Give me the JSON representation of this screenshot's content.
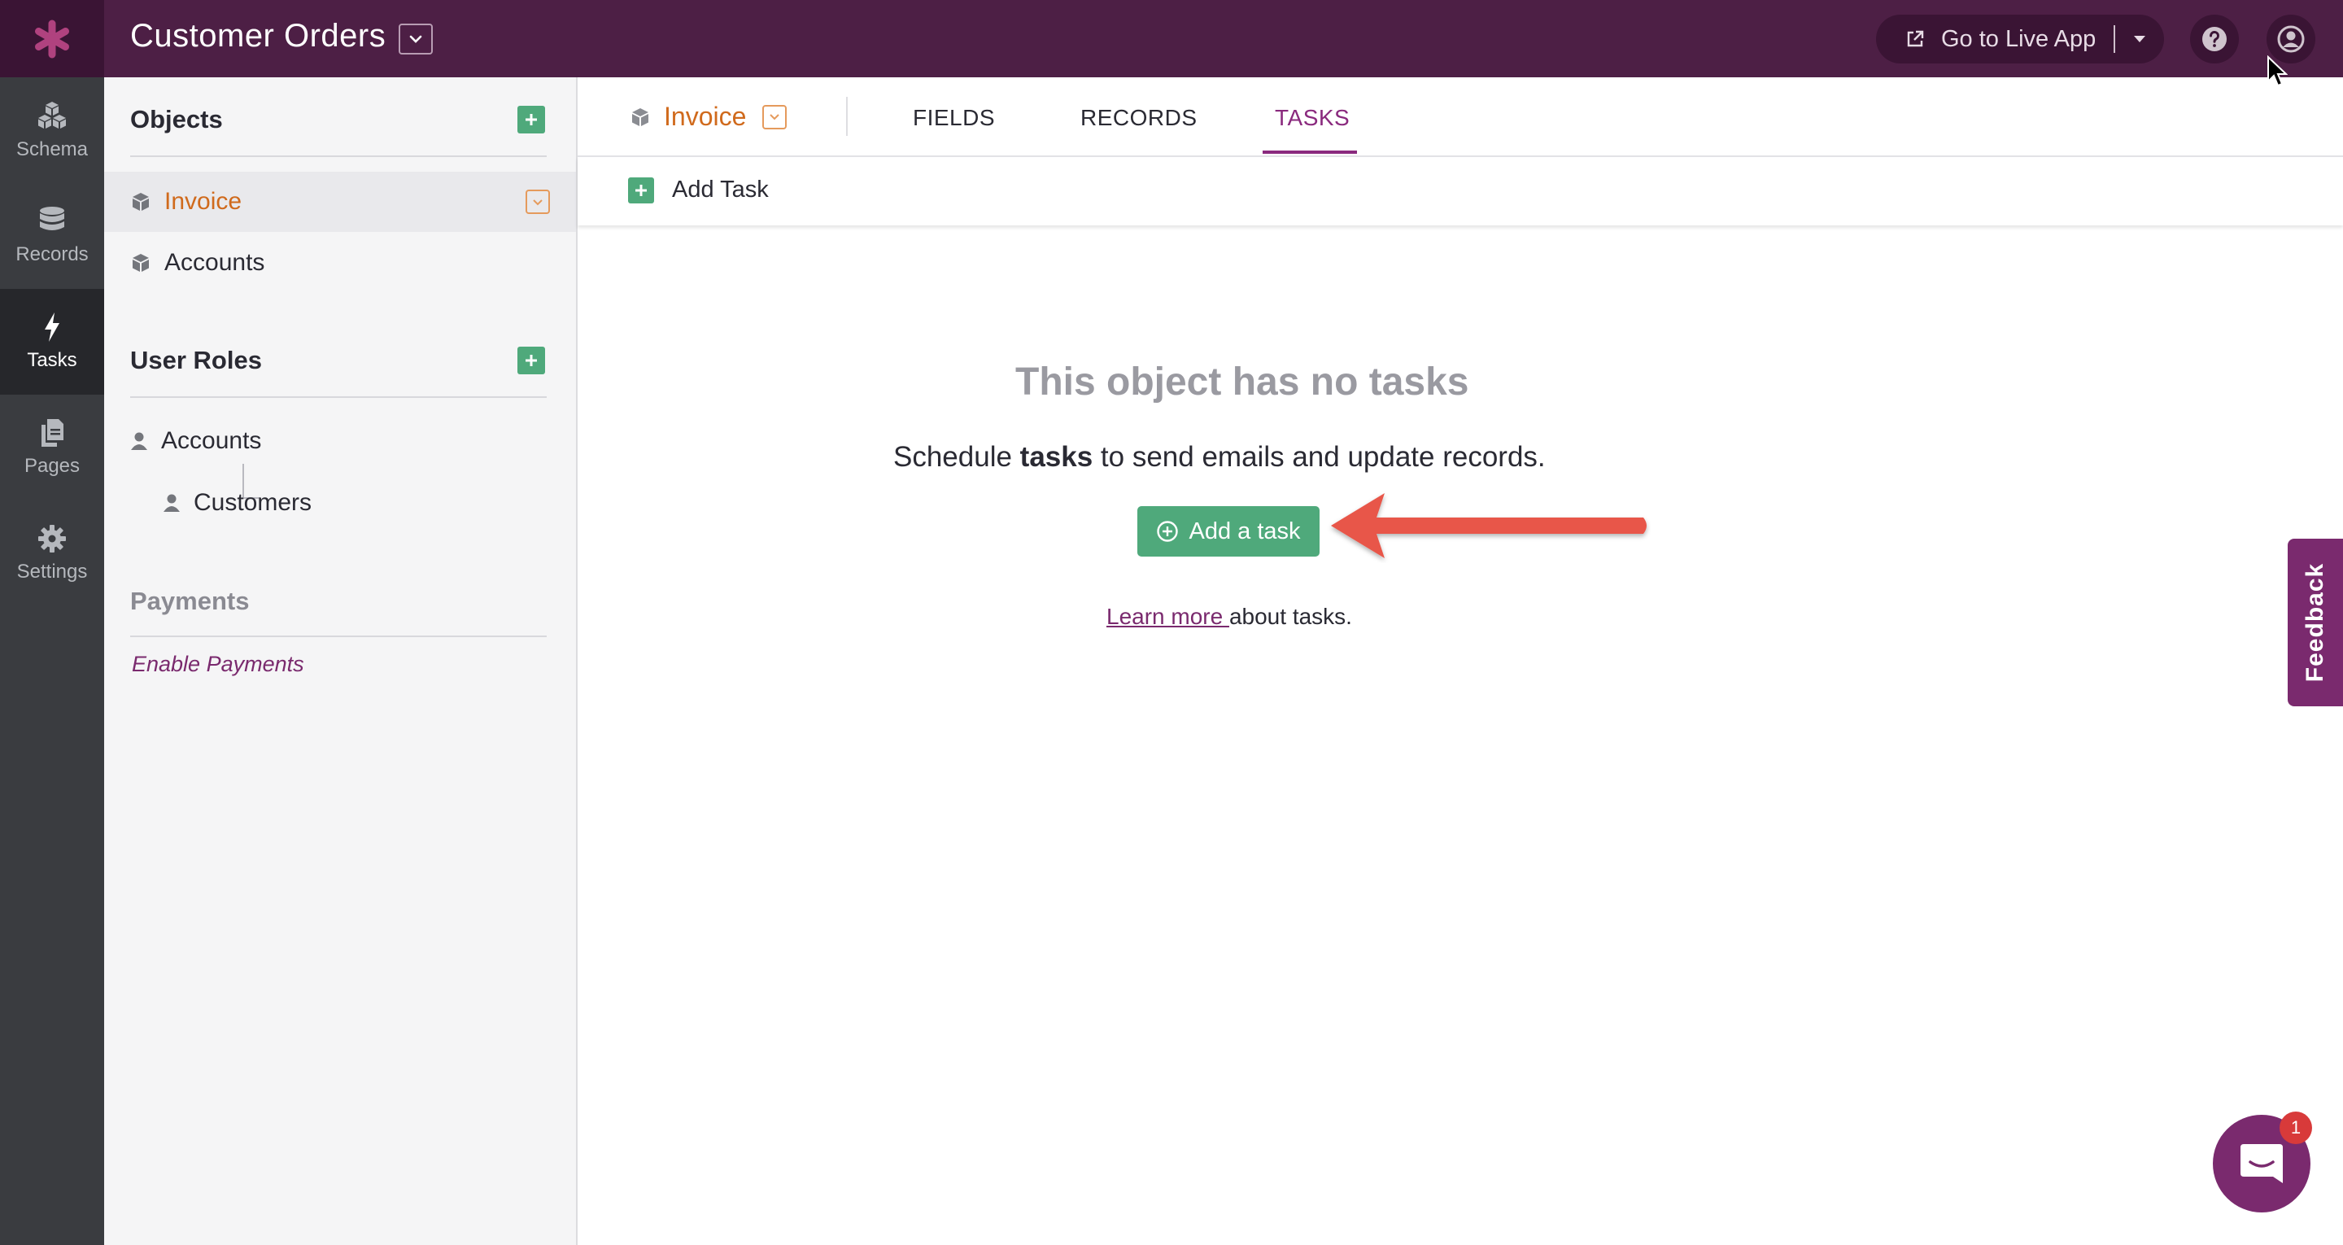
{
  "app": {
    "title": "Customer Orders"
  },
  "header": {
    "live_app_label": "Go to Live App",
    "help_icon": "help-circle-icon",
    "account_icon": "user-circle-icon"
  },
  "nav": {
    "items": [
      {
        "label": "Schema",
        "icon": "cubes-icon",
        "active": false
      },
      {
        "label": "Records",
        "icon": "database-icon",
        "active": false
      },
      {
        "label": "Tasks",
        "icon": "bolt-icon",
        "active": true
      },
      {
        "label": "Pages",
        "icon": "pages-icon",
        "active": false
      },
      {
        "label": "Settings",
        "icon": "gear-icon",
        "active": false
      }
    ]
  },
  "sidebar": {
    "objects_heading": "Objects",
    "objects": [
      {
        "label": "Invoice",
        "selected": true
      },
      {
        "label": "Accounts",
        "selected": false
      }
    ],
    "user_roles_heading": "User Roles",
    "user_roles": [
      {
        "label": "Accounts"
      },
      {
        "label": "Customers"
      }
    ],
    "payments_heading": "Payments",
    "enable_payments": "Enable Payments"
  },
  "main": {
    "object_name": "Invoice",
    "tabs": [
      {
        "label": "FIELDS",
        "active": false
      },
      {
        "label": "RECORDS",
        "active": false
      },
      {
        "label": "TASKS",
        "active": true
      }
    ],
    "toolbar_add_task": "Add Task",
    "empty_state": {
      "title": "This object has no tasks",
      "desc_before": "Schedule ",
      "desc_bold": "tasks",
      "desc_after": " to send emails and update records.",
      "button_label": "Add a task",
      "learn_more": "Learn more ",
      "learn_after": "about tasks."
    }
  },
  "feedback_label": "Feedback",
  "chat_badge": "1",
  "colors": {
    "topbar": "#4d1f45",
    "accent_green": "#4fa97b",
    "accent_purple": "#8a2a7e",
    "object_orange": "#d06a1c",
    "arrow_red": "#e8574a"
  }
}
